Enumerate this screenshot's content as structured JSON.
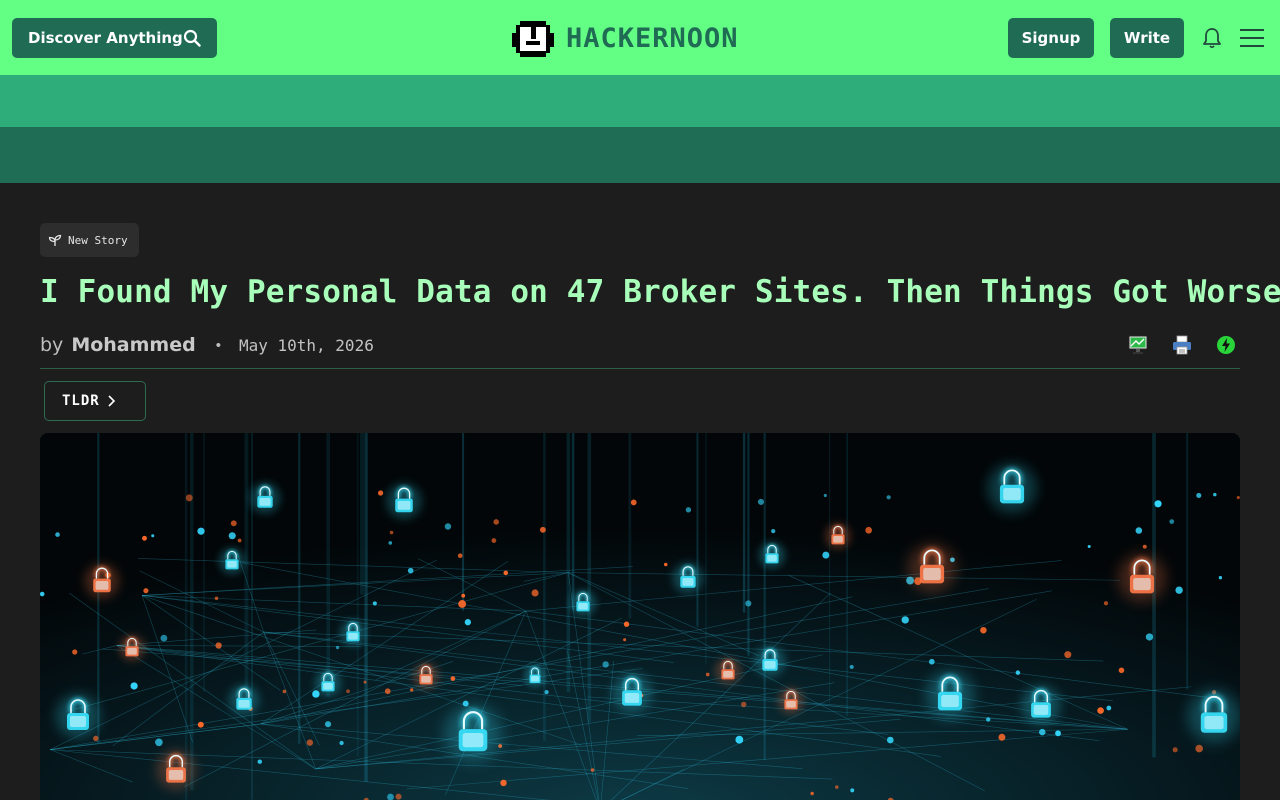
{
  "nav": {
    "discover_label": "Discover Anything",
    "logo_text": "HACKERNOON",
    "signup_label": "Signup",
    "write_label": "Write",
    "brand_color": "#63ff85",
    "button_color": "#1f6b54"
  },
  "story": {
    "badge_label": "New Story",
    "title": "I Found My Personal Data on 47 Broker Sites. Then Things Got Worse",
    "by_label": "by",
    "author": "Mohammed",
    "separator": "•",
    "date": "May 10th, 2026",
    "tldr_label": "TLDR"
  },
  "icons": {
    "search": "search-icon",
    "bell": "bell-icon",
    "menu": "hamburger-menu-icon",
    "sprout": "sprout-icon",
    "monitor": "monitor-icon",
    "print": "printer-icon",
    "lightning": "lightning-icon",
    "chevron": "chevron-right-icon"
  },
  "hero_image": {
    "description_icons": "padlock-network-graphic"
  }
}
